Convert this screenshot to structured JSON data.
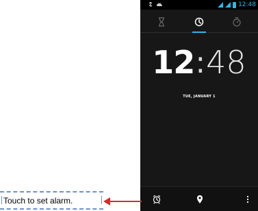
{
  "status_bar": {
    "time": "12:48",
    "icons": {
      "usb": "usb-icon",
      "cloud": "cloud-icon",
      "wifi": "wifi-icon",
      "signal": "signal-icon",
      "battery": "battery-icon"
    }
  },
  "clock_tabs": [
    {
      "name": "timer",
      "icon": "hourglass-icon",
      "active": false
    },
    {
      "name": "clock",
      "icon": "clock-icon",
      "active": true
    },
    {
      "name": "stopwatch",
      "icon": "stopwatch-icon",
      "active": false
    }
  ],
  "clock": {
    "hour": "12",
    "separator": ":",
    "minutes": "48",
    "date": "TUE, JANUARY 1"
  },
  "bottom_bar": {
    "alarm_icon": "alarm-icon",
    "cities_icon": "location-pin-icon",
    "menu_icon": "more-vert-icon"
  },
  "annotation": {
    "text": "Touch to set alarm."
  },
  "colors": {
    "accent": "#33b5e5",
    "background": "#171717",
    "arrow": "#e0262f",
    "dashes": "#6f91c9"
  }
}
